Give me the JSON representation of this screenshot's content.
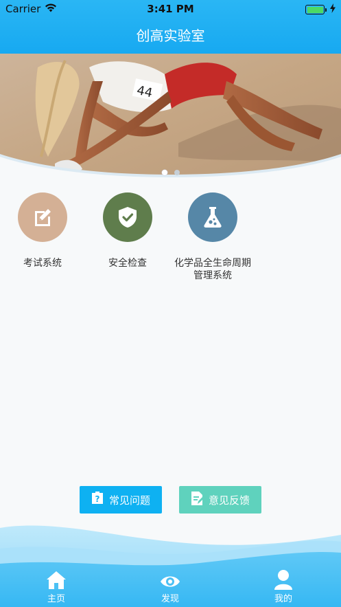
{
  "status_bar": {
    "carrier": "Carrier",
    "time": "3:41 PM",
    "battery_level": 1.0
  },
  "header": {
    "title": "创高实验室"
  },
  "banner": {
    "slide_count": 2,
    "active_slide": 1
  },
  "features": [
    {
      "label": "考试系统",
      "icon": "edit-icon",
      "color": "#d4b095"
    },
    {
      "label": "安全检查",
      "icon": "shield-check-icon",
      "color": "#5f7d4c"
    },
    {
      "label_line1": "化学品全生命周期",
      "label_line2": "管理系统",
      "icon": "flask-icon",
      "color": "#5687a7"
    }
  ],
  "actions": {
    "faq_label": "常见问题",
    "feedback_label": "意见反馈"
  },
  "tabbar": {
    "home_label": "主页",
    "discover_label": "发现",
    "mine_label": "我的"
  },
  "colors": {
    "header": "#1aaaf2",
    "faq_button": "#0eb1f2",
    "feedback_button": "#5fd2bd"
  }
}
